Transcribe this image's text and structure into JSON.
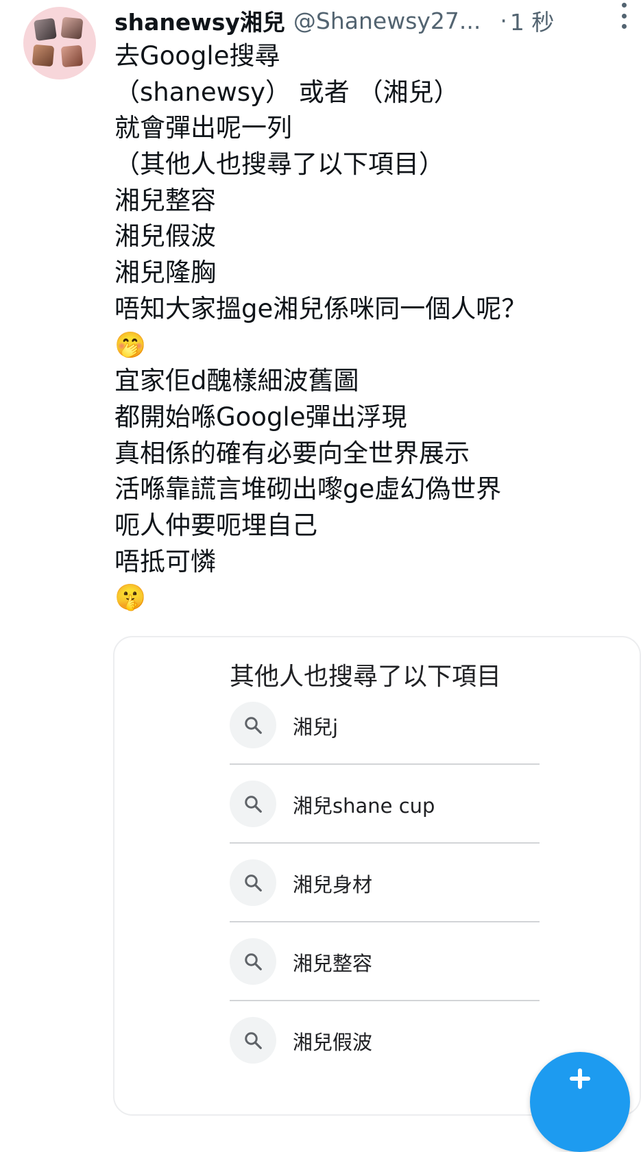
{
  "tweet": {
    "display_name": "shanewsy湘兒",
    "handle": "@Shanewsy27...",
    "dot": "·",
    "time": "1 秒",
    "lines": [
      "去Google搜尋",
      "（shanewsy） 或者 （湘兒）",
      "就會彈出呢一列",
      "（其他人也搜尋了以下項目）",
      "湘兒整容",
      "湘兒假波",
      "湘兒隆胸",
      "唔知大家搵ge湘兒係咪同一個人呢？",
      "🤭",
      "宜家佢d醜樣細波舊圖",
      "都開始喺Google彈出浮現",
      "真相係的確有必要向全世界展示",
      "活喺靠謊言堆砌出嚟ge虛幻偽世界",
      "呃人仲要呃埋自己",
      "唔抵可憐",
      "🤫"
    ]
  },
  "card": {
    "title": "其他人也搜尋了以下項目",
    "items": [
      {
        "label": "湘兒j"
      },
      {
        "label": "湘兒shane cup"
      },
      {
        "label": "湘兒身材"
      },
      {
        "label": "湘兒整容"
      },
      {
        "label": "湘兒假波"
      }
    ]
  },
  "icons": {
    "avatar": "avatar-collage",
    "more": "more-vertical-icon",
    "search": "search-icon",
    "compose": "plus-icon"
  },
  "colors": {
    "text": "#0f1419",
    "secondary": "#536471",
    "accent": "#1d9bf0",
    "avatar_bg": "#f7d6da"
  }
}
